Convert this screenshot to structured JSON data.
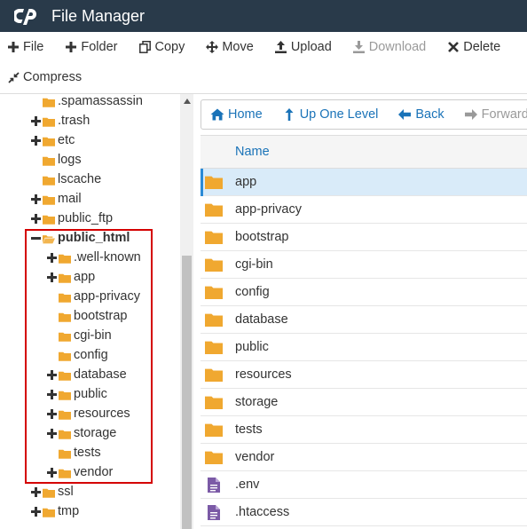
{
  "header": {
    "title": "File Manager",
    "logo_icon": "cpanel-logo-icon"
  },
  "toolbar": {
    "row1": [
      {
        "label": "File",
        "icon": "plus-icon",
        "disabled": false
      },
      {
        "label": "Folder",
        "icon": "plus-icon",
        "disabled": false
      },
      {
        "label": "Copy",
        "icon": "copy-icon",
        "disabled": false
      },
      {
        "label": "Move",
        "icon": "move-icon",
        "disabled": false
      },
      {
        "label": "Upload",
        "icon": "upload-icon",
        "disabled": false
      },
      {
        "label": "Download",
        "icon": "download-icon",
        "disabled": true
      },
      {
        "label": "Delete",
        "icon": "close-icon",
        "disabled": false
      }
    ],
    "row2": [
      {
        "label": "Compress",
        "icon": "compress-icon",
        "disabled": false
      }
    ]
  },
  "tree": {
    "items": [
      {
        "label": ".spamassassin",
        "toggle": "none"
      },
      {
        "label": ".trash",
        "toggle": "plus"
      },
      {
        "label": "etc",
        "toggle": "plus"
      },
      {
        "label": "logs",
        "toggle": "none"
      },
      {
        "label": "lscache",
        "toggle": "none"
      },
      {
        "label": "mail",
        "toggle": "plus"
      },
      {
        "label": "public_ftp",
        "toggle": "plus"
      },
      {
        "label": "public_html",
        "toggle": "minus",
        "open": true
      },
      {
        "label": ".well-known",
        "toggle": "plus"
      },
      {
        "label": "app",
        "toggle": "plus"
      },
      {
        "label": "app-privacy",
        "toggle": "none"
      },
      {
        "label": "bootstrap",
        "toggle": "none"
      },
      {
        "label": "cgi-bin",
        "toggle": "none"
      },
      {
        "label": "config",
        "toggle": "none"
      },
      {
        "label": "database",
        "toggle": "plus"
      },
      {
        "label": "public",
        "toggle": "plus"
      },
      {
        "label": "resources",
        "toggle": "plus"
      },
      {
        "label": "storage",
        "toggle": "plus"
      },
      {
        "label": "tests",
        "toggle": "none"
      },
      {
        "label": "vendor",
        "toggle": "plus"
      },
      {
        "label": "ssl",
        "toggle": "plus"
      },
      {
        "label": "tmp",
        "toggle": "plus"
      }
    ]
  },
  "nav": [
    {
      "label": "Home",
      "icon": "home-icon",
      "disabled": false
    },
    {
      "label": "Up One Level",
      "icon": "level-up-icon",
      "disabled": false
    },
    {
      "label": "Back",
      "icon": "arrow-left-icon",
      "disabled": false
    },
    {
      "label": "Forward",
      "icon": "arrow-right-icon",
      "disabled": true
    }
  ],
  "files": {
    "header": "Name",
    "rows": [
      {
        "name": "app",
        "type": "folder",
        "selected": true
      },
      {
        "name": "app-privacy",
        "type": "folder"
      },
      {
        "name": "bootstrap",
        "type": "folder"
      },
      {
        "name": "cgi-bin",
        "type": "folder"
      },
      {
        "name": "config",
        "type": "folder"
      },
      {
        "name": "database",
        "type": "folder"
      },
      {
        "name": "public",
        "type": "folder"
      },
      {
        "name": "resources",
        "type": "folder"
      },
      {
        "name": "storage",
        "type": "folder"
      },
      {
        "name": "tests",
        "type": "folder"
      },
      {
        "name": "vendor",
        "type": "folder"
      },
      {
        "name": ".env",
        "type": "file"
      },
      {
        "name": ".htaccess",
        "type": "file"
      }
    ]
  },
  "colors": {
    "header_bg": "#293a4a",
    "link": "#1a73b8",
    "folder": "#f0a830",
    "file": "#7b5aa6",
    "highlight": "#d40000",
    "selected_row": "#d9ebf9"
  }
}
